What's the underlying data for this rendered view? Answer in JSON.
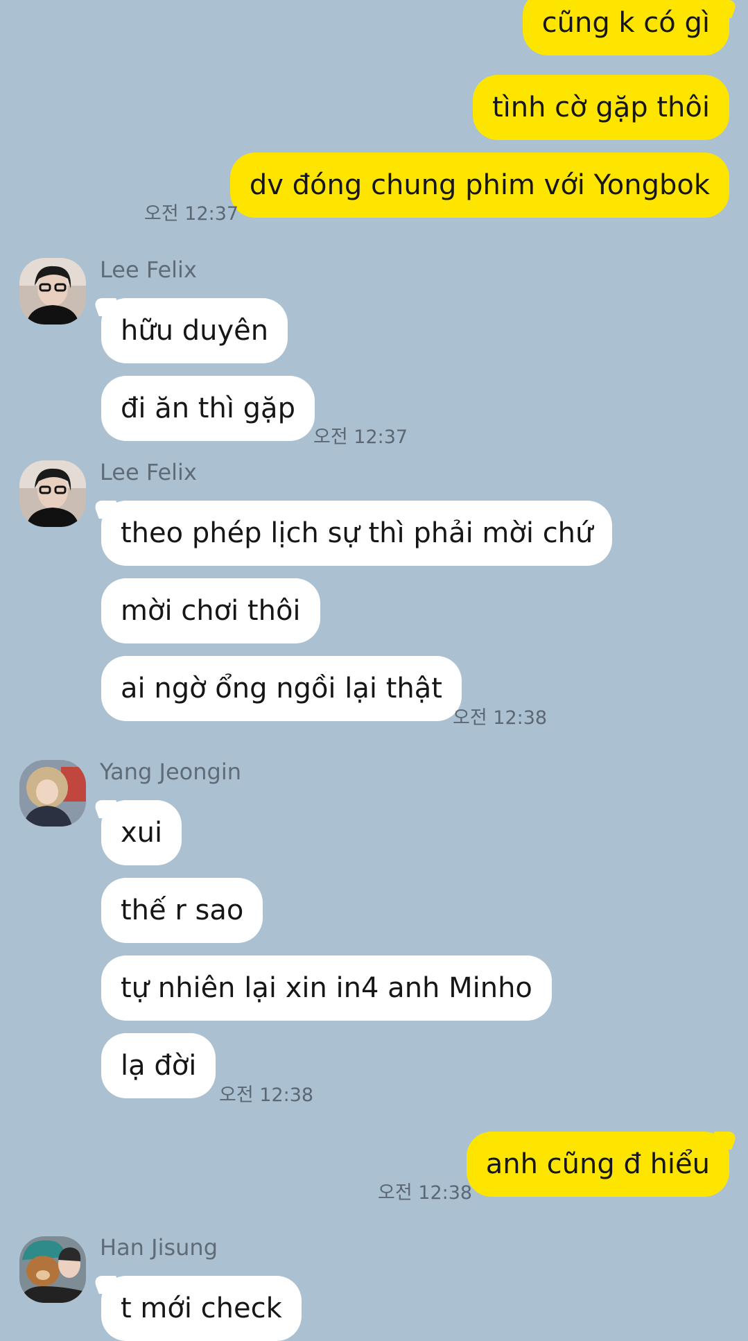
{
  "theme": {
    "background": "#abc1d1",
    "outgoing_bubble": "#fee500",
    "incoming_bubble": "#ffffff",
    "timestamp_color": "#5b6772",
    "sender_name_color": "#5f6b76"
  },
  "outgoing_group_1": {
    "messages": [
      "cũng k có gì",
      "tình cờ gặp thôi",
      "dv đóng chung phim với Yongbok"
    ],
    "time": "오전 12:37"
  },
  "group_felix_1": {
    "sender": "Lee Felix",
    "avatar_icon": "profile-photo-lee-felix",
    "messages": [
      "hữu duyên",
      "đi ăn thì gặp"
    ],
    "time": "오전 12:37"
  },
  "group_felix_2": {
    "sender": "Lee Felix",
    "avatar_icon": "profile-photo-lee-felix",
    "messages": [
      "theo phép lịch sự thì phải mời chứ",
      "mời chơi thôi",
      "ai ngờ ổng ngồi lại thật"
    ],
    "time": "오전 12:38"
  },
  "group_jeongin": {
    "sender": "Yang Jeongin",
    "avatar_icon": "profile-photo-yang-jeongin",
    "messages": [
      "xui",
      "thế r sao",
      "tự nhiên lại xin in4 anh Minho",
      "lạ đời"
    ],
    "time": "오전 12:38"
  },
  "outgoing_group_2": {
    "messages": [
      "anh cũng đ hiểu"
    ],
    "time": "오전 12:38"
  },
  "group_jisung": {
    "sender": "Han Jisung",
    "avatar_icon": "profile-photo-han-jisung",
    "messages": [
      "t mới check"
    ]
  }
}
